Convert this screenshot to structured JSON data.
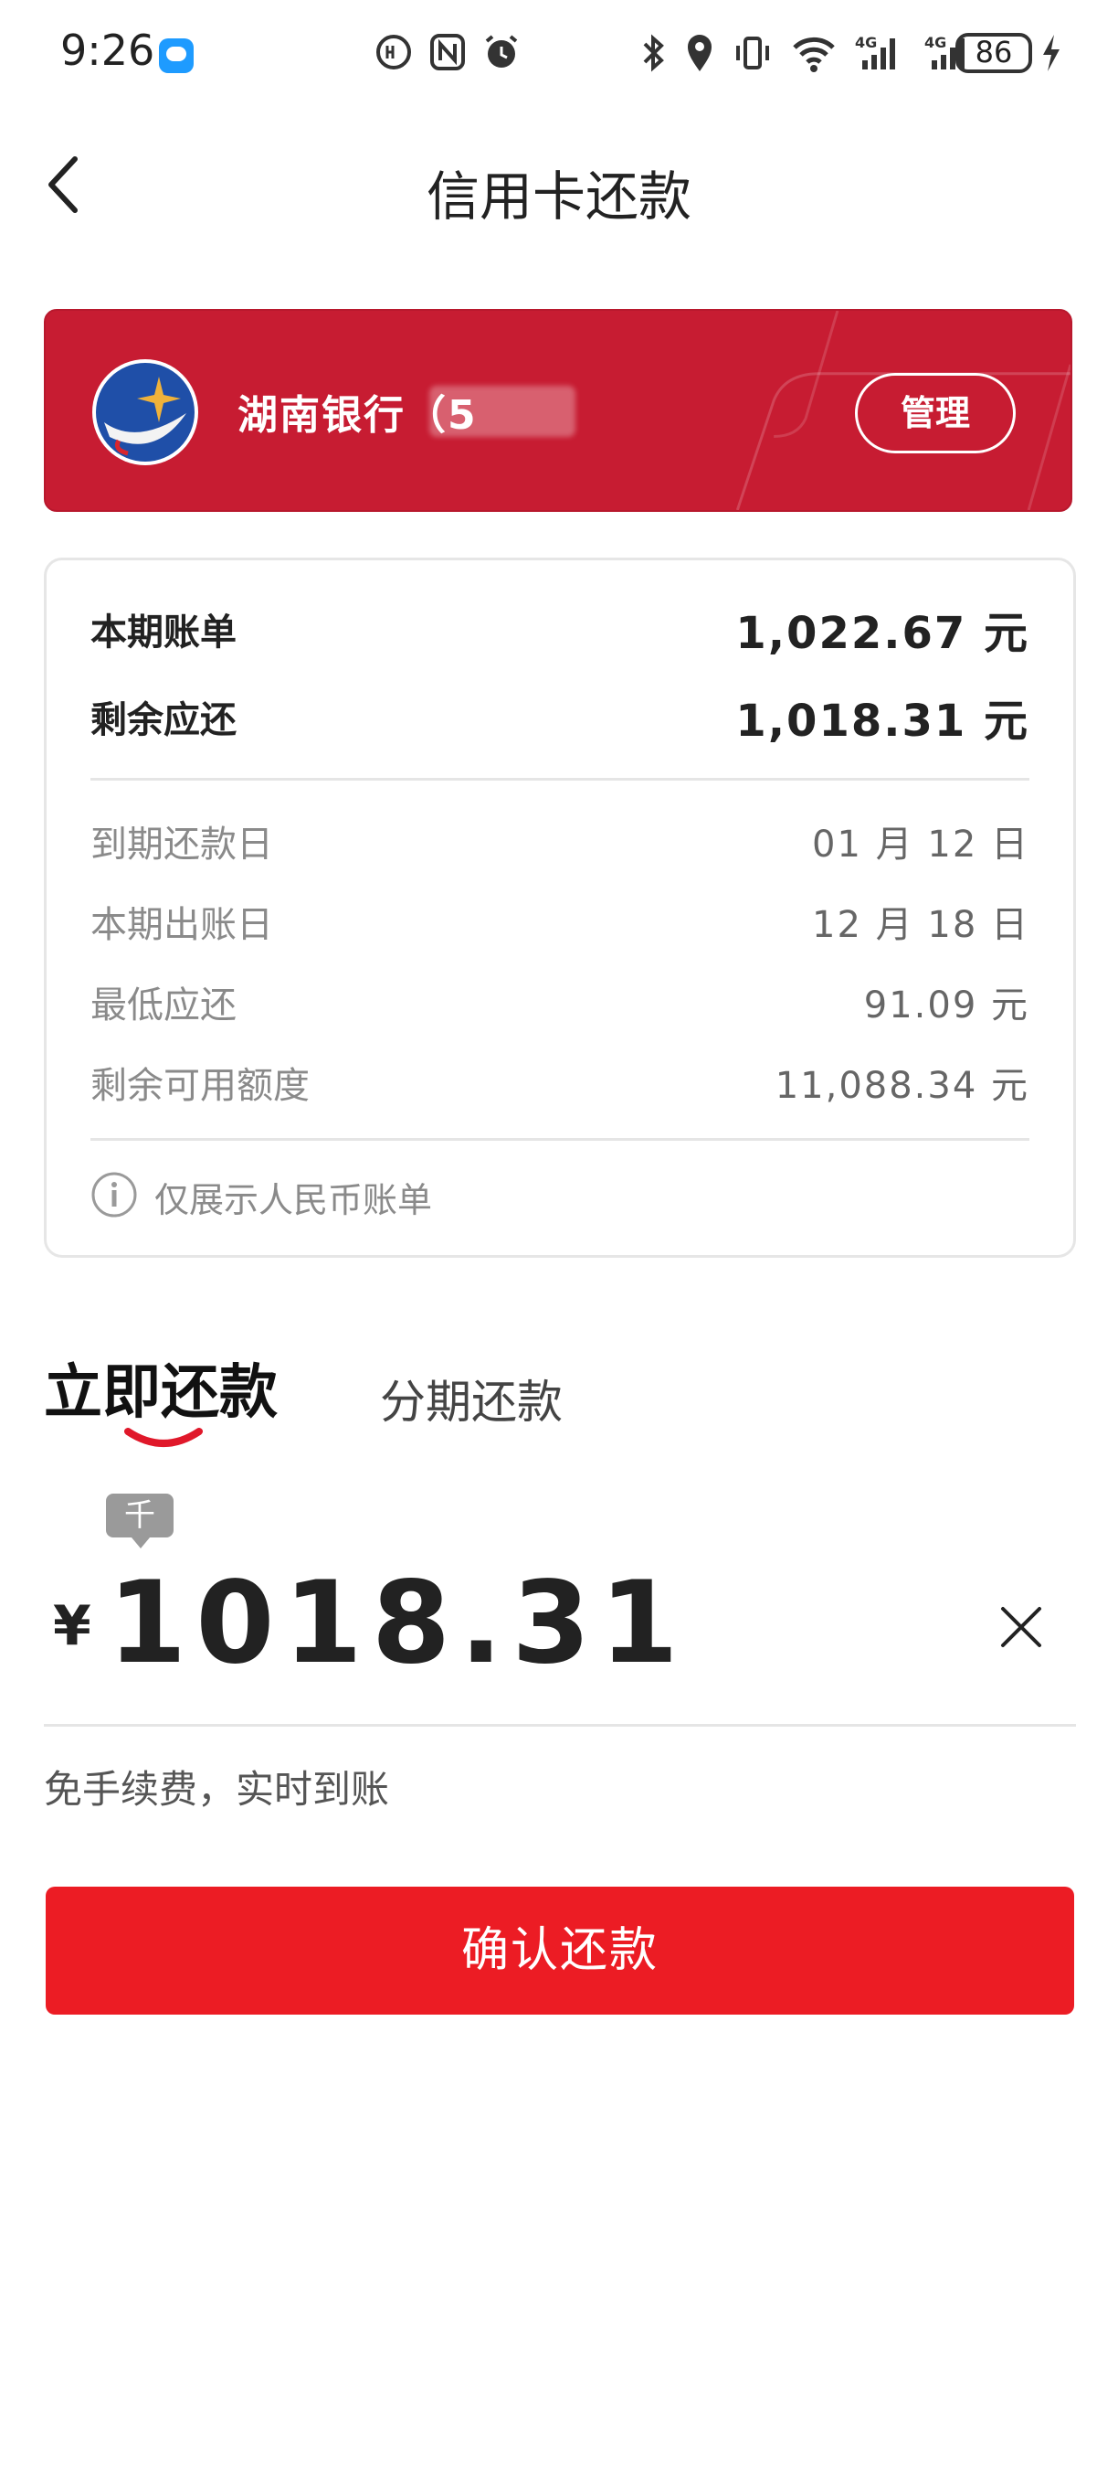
{
  "status_bar": {
    "time": "9:26",
    "battery": "86"
  },
  "nav": {
    "title": "信用卡还款"
  },
  "card": {
    "bank_name": "湖南银行（5",
    "manage_label": "管理"
  },
  "bill": {
    "main_rows": [
      {
        "label": "本期账单",
        "value": "1,022.67 元"
      },
      {
        "label": "剩余应还",
        "value": "1,018.31 元"
      }
    ],
    "detail_rows": [
      {
        "label": "到期还款日",
        "value": "01 月 12 日"
      },
      {
        "label": "本期出账日",
        "value": "12 月 18 日"
      },
      {
        "label": "最低应还",
        "value": "91.09 元"
      },
      {
        "label": "剩余可用额度",
        "value": "11,088.34 元"
      }
    ],
    "note": "仅展示人民币账单"
  },
  "payment": {
    "tabs": [
      {
        "label": "立即还款",
        "active": true
      },
      {
        "label": "分期还款",
        "active": false
      }
    ],
    "unit_tip": "千",
    "currency_symbol": "¥",
    "amount": "1018.31",
    "fee_note": "免手续费，实时到账",
    "confirm_label": "确认还款"
  },
  "colors": {
    "brand_red": "#c71c32",
    "button_red": "#ec1c24"
  }
}
